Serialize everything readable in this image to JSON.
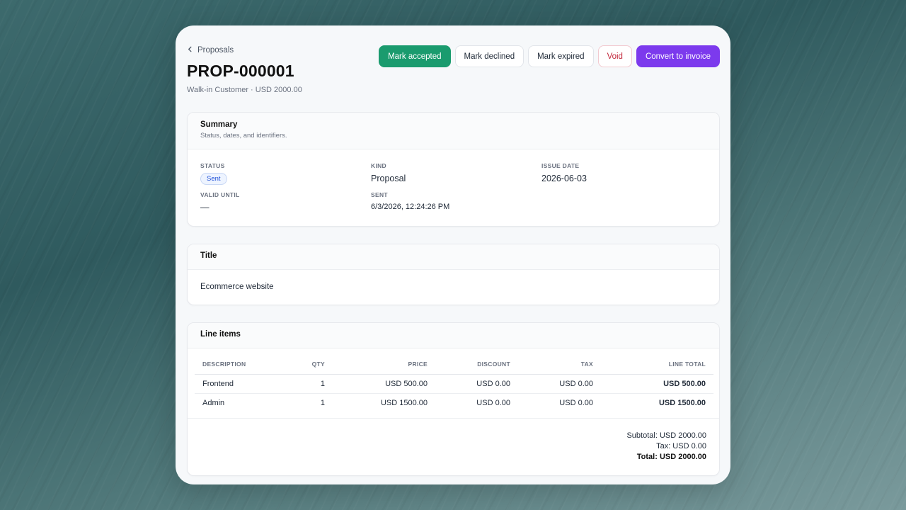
{
  "header": {
    "back_label": "Proposals",
    "title": "PROP-000001",
    "subtitle": "Walk-in Customer · USD 2000.00"
  },
  "actions": {
    "accept": "Mark accepted",
    "decline": "Mark declined",
    "expire": "Mark expired",
    "void": "Void",
    "convert": "Convert to invoice"
  },
  "colors": {
    "accept": "#1a9b6e",
    "void": "#c2263a",
    "convert": "#7c3aed"
  },
  "summary": {
    "title": "Summary",
    "description": "Status, dates, and identifiers.",
    "status_label": "STATUS",
    "status_value": "Sent",
    "kind_label": "KIND",
    "kind_value": "Proposal",
    "issue_date_label": "ISSUE DATE",
    "issue_date_value": "2026-06-03",
    "valid_until_label": "VALID UNTIL",
    "valid_until_value": "—",
    "sent_label": "SENT",
    "sent_value": "6/3/2026, 12:24:26 PM"
  },
  "title_section": {
    "heading": "Title",
    "value": "Ecommerce website"
  },
  "line_items": {
    "heading": "Line items",
    "columns": {
      "description": "DESCRIPTION",
      "qty": "QTY",
      "price": "PRICE",
      "discount": "DISCOUNT",
      "tax": "TAX",
      "line_total": "LINE TOTAL"
    },
    "rows": [
      {
        "description": "Frontend",
        "qty": "1",
        "price": "USD 500.00",
        "discount": "USD 0.00",
        "tax": "USD 0.00",
        "line_total": "USD 500.00"
      },
      {
        "description": "Admin",
        "qty": "1",
        "price": "USD 1500.00",
        "discount": "USD 0.00",
        "tax": "USD 0.00",
        "line_total": "USD 1500.00"
      }
    ],
    "subtotal": "Subtotal: USD 2000.00",
    "tax": "Tax: USD 0.00",
    "total": "Total: USD 2000.00"
  }
}
